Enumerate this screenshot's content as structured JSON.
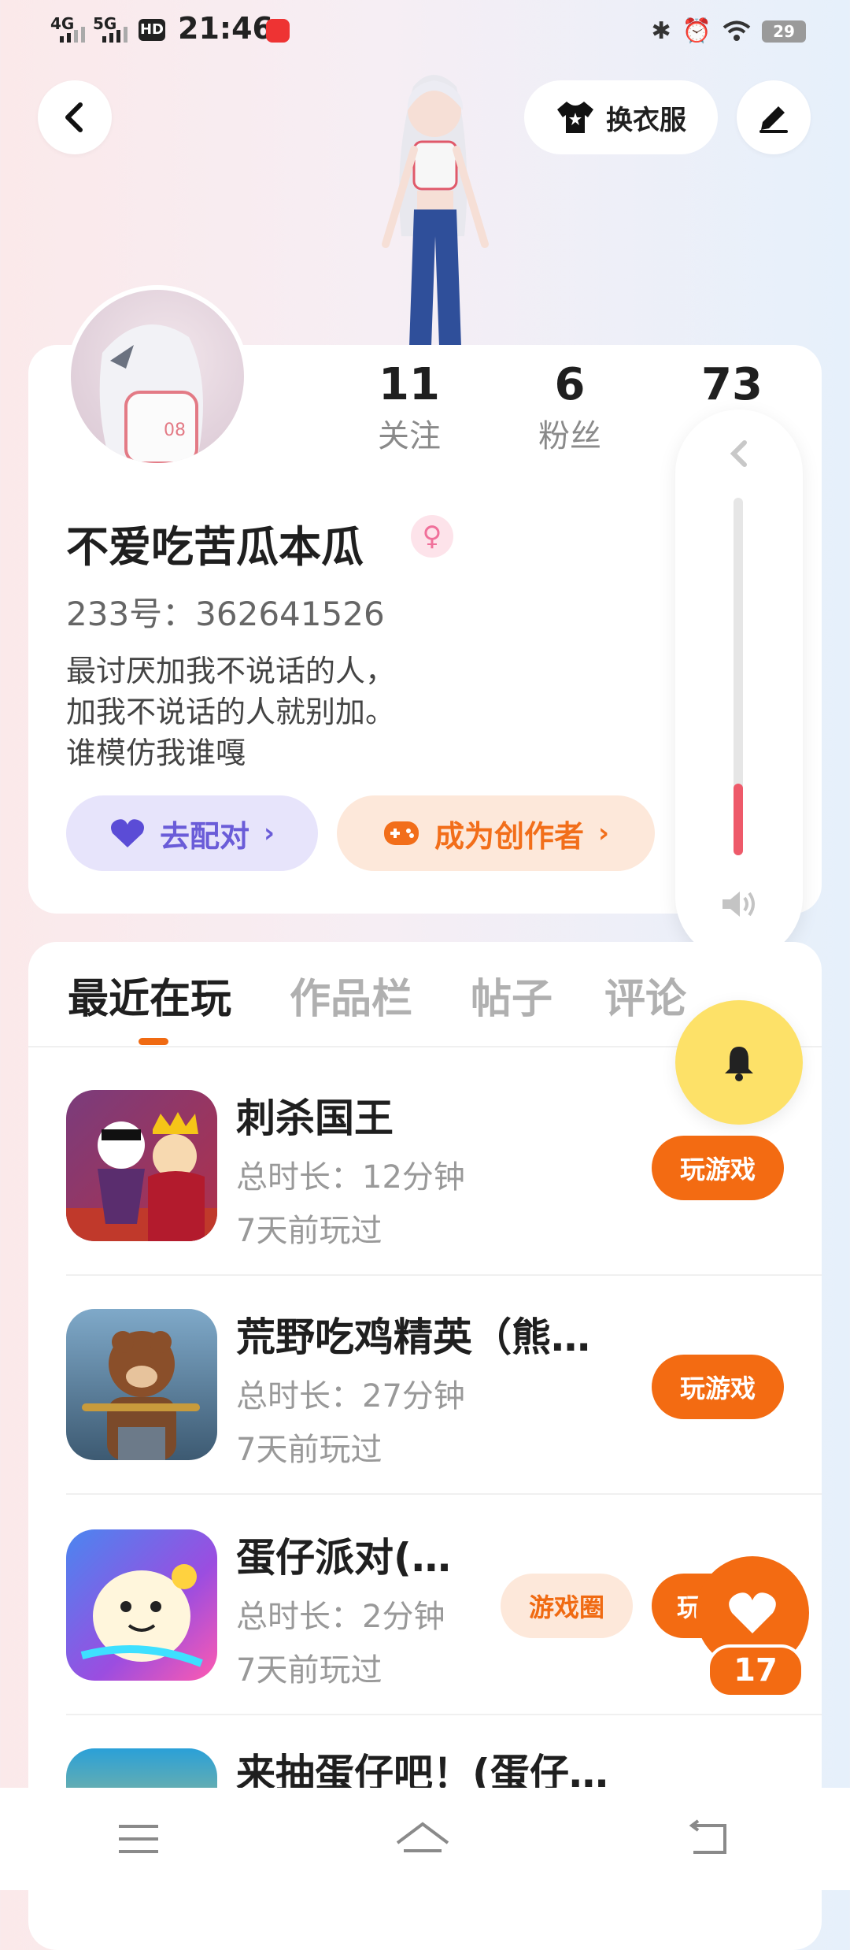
{
  "status_bar": {
    "signal_1": "4G",
    "signal_2": "5G",
    "hd": "HD",
    "time": "21:46",
    "battery": "29"
  },
  "header": {
    "back_icon": "chevron-left-icon",
    "dress_up_label": "换衣服",
    "edit_icon": "pencil-icon"
  },
  "profile": {
    "stats": [
      {
        "value": "11",
        "label": "关注"
      },
      {
        "value": "6",
        "label": "粉丝"
      },
      {
        "value": "73",
        "label": ""
      }
    ],
    "name": "不爱吃苦瓜本瓜",
    "gender_icon": "female-icon",
    "uid": "233号：362641526",
    "bio_lines": [
      "最讨厌加我不说话的人，",
      "加我不说话的人就别加。",
      "谁模仿我谁嘎"
    ],
    "pair_label": "去配对",
    "creator_label": "成为创作者"
  },
  "volume": {
    "level": 0.2,
    "accent": "#ee5a6a"
  },
  "tabs": [
    {
      "label": "最近在玩",
      "active": true
    },
    {
      "label": "作品栏",
      "active": false
    },
    {
      "label": "帖子",
      "active": false
    },
    {
      "label": "评论",
      "active": false
    }
  ],
  "games": [
    {
      "title": "刺杀国王",
      "duration": "总时长：12分钟",
      "last_played": "7天前玩过",
      "play_label": "玩游戏"
    },
    {
      "title": "荒野吃鸡精英（熊…",
      "duration": "总时长：27分钟",
      "last_played": "7天前玩过",
      "play_label": "玩游戏"
    },
    {
      "title": "蛋仔派对(…",
      "duration": "总时长：2分钟",
      "last_played": "7天前玩过",
      "circle_label": "游戏圈",
      "play_label": "玩"
    },
    {
      "title": "来抽蛋仔吧！(蛋仔…"
    }
  ],
  "like": {
    "count": "17"
  },
  "colors": {
    "accent": "#f36b12",
    "pair": "#6a5cd8",
    "bell": "#fde168"
  }
}
